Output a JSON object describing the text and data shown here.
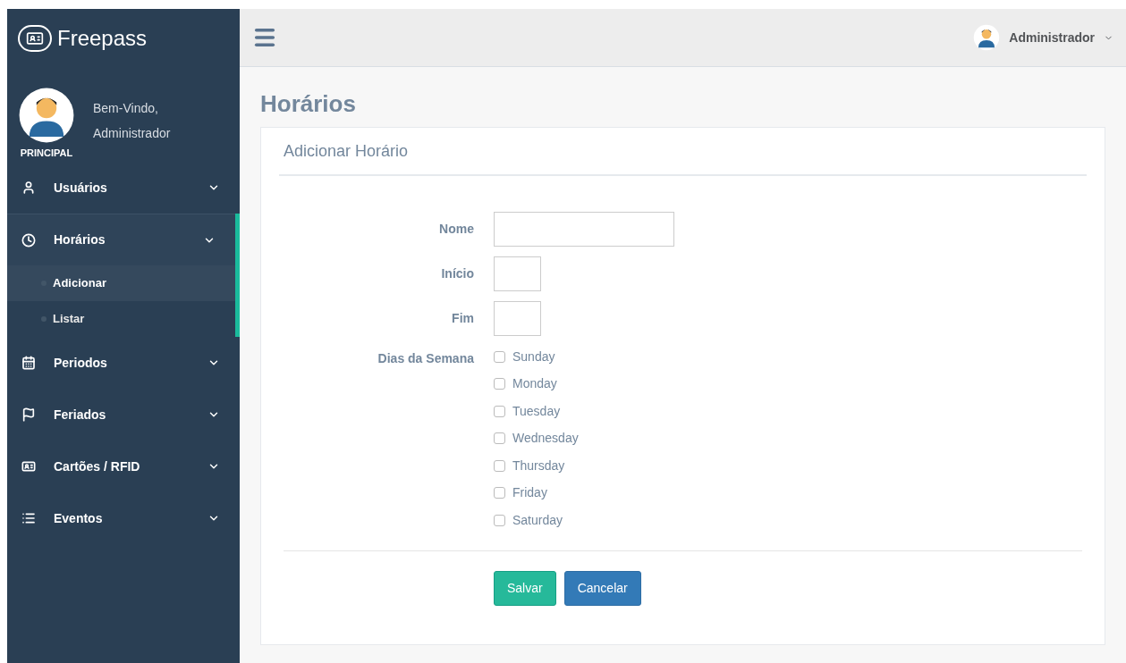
{
  "brand": {
    "name": "Freepass"
  },
  "profile": {
    "greeting": "Bem-Vindo,",
    "name": "Administrador",
    "section": "PRINCIPAL"
  },
  "sidebar": {
    "items": [
      {
        "label": "Usuários",
        "selected": false
      },
      {
        "label": "Horários",
        "selected": true,
        "children": [
          {
            "label": "Adicionar",
            "selected": true
          },
          {
            "label": "Listar",
            "selected": false
          }
        ]
      },
      {
        "label": "Periodos",
        "selected": false
      },
      {
        "label": "Feriados",
        "selected": false
      },
      {
        "label": "Cartões / RFID",
        "selected": false
      },
      {
        "label": "Eventos",
        "selected": false
      }
    ]
  },
  "topbar": {
    "user": "Administrador"
  },
  "page": {
    "title": "Horários",
    "card_title": "Adicionar Horário",
    "fields": [
      {
        "label": "Nome",
        "kind": "text"
      },
      {
        "label": "Início",
        "kind": "time"
      },
      {
        "label": "Fim",
        "kind": "time"
      }
    ],
    "days_label": "Dias da Semana",
    "days": [
      {
        "label": "Sunday",
        "checked": false
      },
      {
        "label": "Monday",
        "checked": false
      },
      {
        "label": "Tuesday",
        "checked": false
      },
      {
        "label": "Wednesday",
        "checked": false
      },
      {
        "label": "Thursday",
        "checked": false
      },
      {
        "label": "Friday",
        "checked": false
      },
      {
        "label": "Saturday",
        "checked": false
      }
    ],
    "buttons": [
      {
        "label": "Salvar",
        "kind": "primary"
      },
      {
        "label": "Cancelar",
        "kind": "secondary"
      }
    ]
  }
}
